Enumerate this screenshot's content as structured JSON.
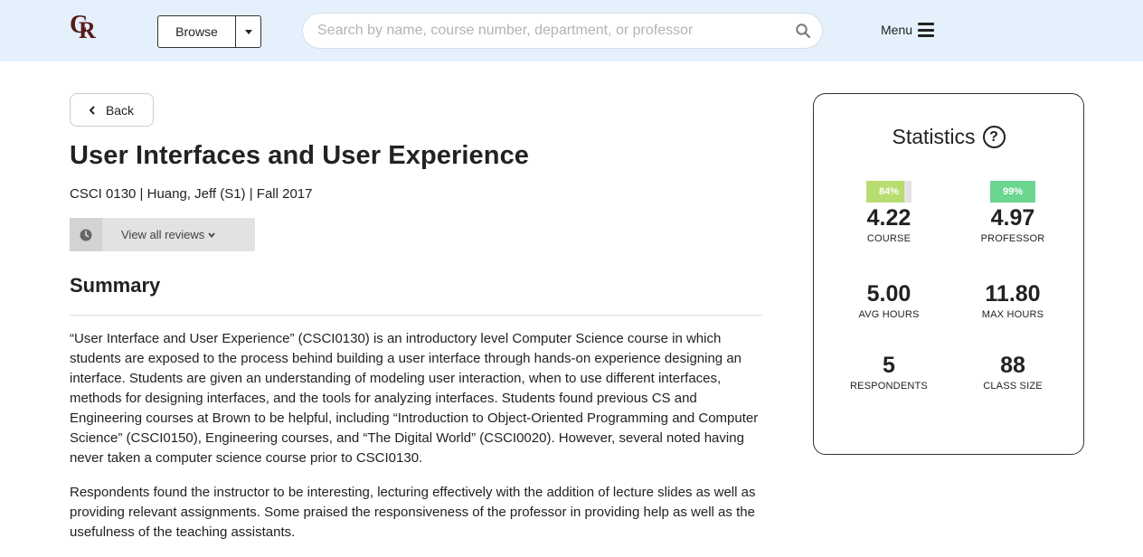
{
  "header": {
    "logo_text": "CR",
    "browse_label": "Browse",
    "search_placeholder": "Search by name, course number, department, or professor",
    "menu_label": "Menu"
  },
  "nav": {
    "back_label": "Back"
  },
  "course": {
    "title": "User Interfaces and User Experience",
    "subtitle": "CSCI 0130 | Huang, Jeff (S1) | Fall 2017",
    "view_reviews_label": "View all reviews"
  },
  "summary": {
    "heading": "Summary",
    "paragraphs": [
      "“User Interface and User Experience” (CSCI0130) is an introductory level Computer Science course in which students are exposed to the process behind building a user interface through hands-on experience designing an interface. Students are given an understanding of modeling user interaction, when to use different interfaces, methods for designing interfaces, and the tools for analyzing interfaces. Students found previous CS and Engineering courses at Brown to be helpful, including “Introduction to Object-Oriented Programming and Computer Science” (CSCI0150), Engineering courses, and “The Digital World” (CSCI0020). However, several noted having never taken a computer science course prior to CSCI0130.",
      "Respondents found the instructor to be interesting, lecturing effectively with the addition of lecture slides as well as providing relevant assignments. Some praised the responsiveness of the professor in providing help as well as the usefulness of the teaching assistants."
    ]
  },
  "stats": {
    "title": "Statistics",
    "course": {
      "percent_label": "84%",
      "percent": 84,
      "color": "#b8dc6f",
      "value": "4.22",
      "label": "COURSE"
    },
    "professor": {
      "percent_label": "99%",
      "percent": 99,
      "color": "#6ad68f",
      "value": "4.97",
      "label": "PROFESSOR"
    },
    "avg_hours": {
      "value": "5.00",
      "label": "AVG HOURS"
    },
    "max_hours": {
      "value": "11.80",
      "label": "MAX HOURS"
    },
    "respondents": {
      "value": "5",
      "label": "RESPONDENTS"
    },
    "class_size": {
      "value": "88",
      "label": "CLASS SIZE"
    }
  }
}
